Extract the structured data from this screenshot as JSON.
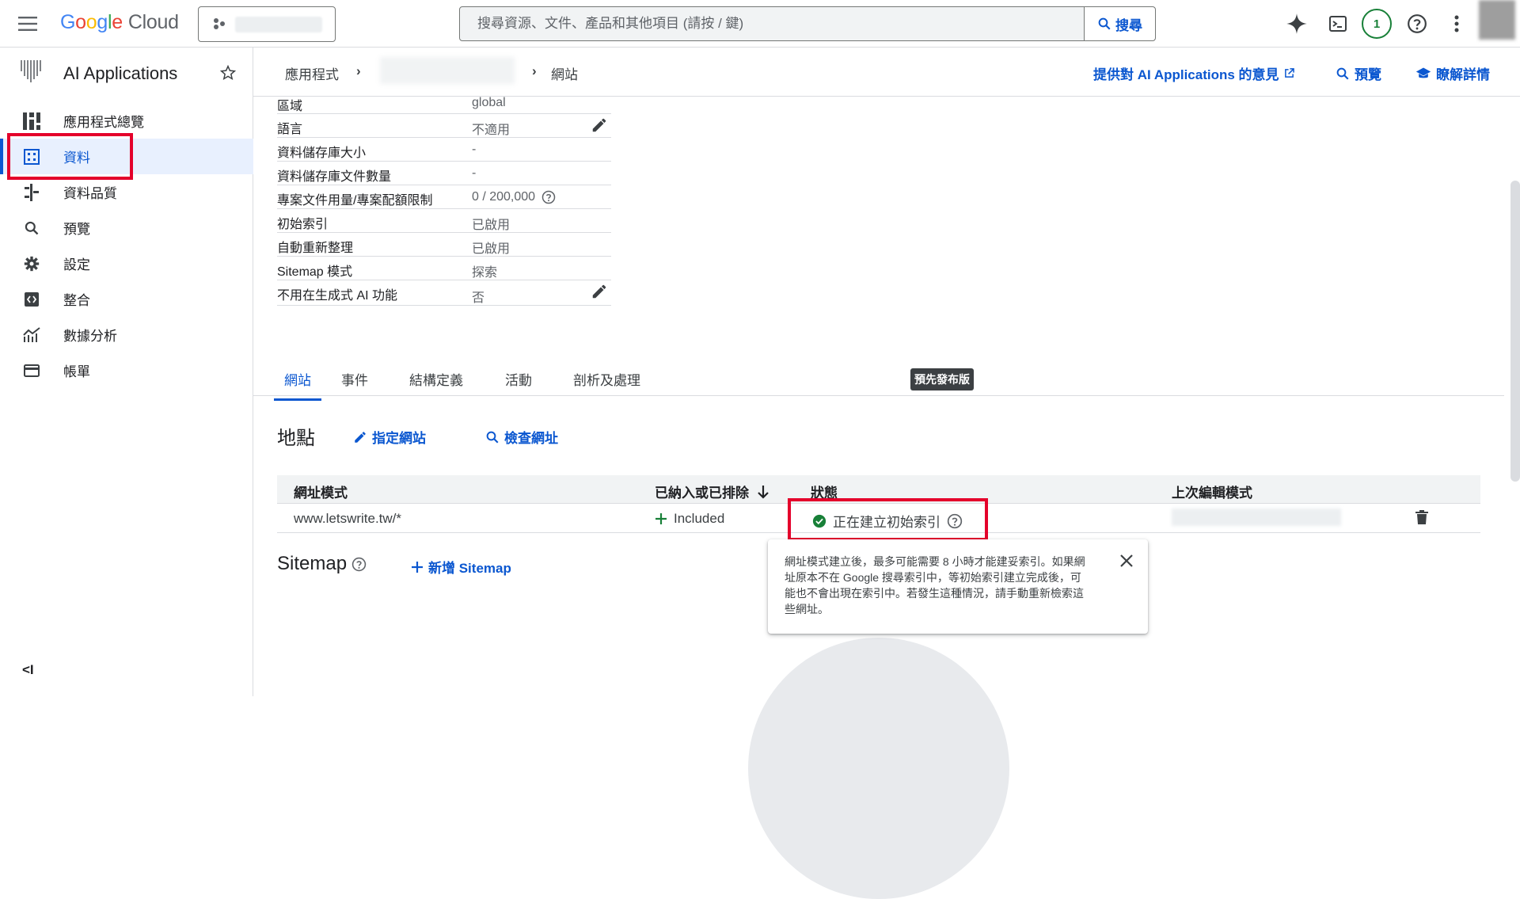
{
  "topbar": {
    "logo_google": "Google",
    "logo_cloud": "Cloud",
    "search_placeholder": "搜尋資源、文件、產品和其他項目 (請按 / 鍵)",
    "search_button": "搜尋",
    "notification_count": "1"
  },
  "sidebar": {
    "app_name": "AI Applications",
    "items": [
      {
        "label": "應用程式總覽",
        "icon": "dashboard-icon"
      },
      {
        "label": "資料",
        "icon": "table-icon"
      },
      {
        "label": "資料品質",
        "icon": "data-quality-icon"
      },
      {
        "label": "預覽",
        "icon": "search-icon"
      },
      {
        "label": "設定",
        "icon": "gear-icon"
      },
      {
        "label": "整合",
        "icon": "code-icon"
      },
      {
        "label": "數據分析",
        "icon": "analytics-icon"
      },
      {
        "label": "帳單",
        "icon": "billing-icon"
      }
    ],
    "collapse_label": "<I"
  },
  "breadcrumb": {
    "root": "應用程式",
    "current": "網站"
  },
  "header_links": {
    "feedback": "提供對 AI Applications 的意見",
    "preview": "預覽",
    "learn_more": "瞭解詳情"
  },
  "details": [
    {
      "key": "區域",
      "value": "global"
    },
    {
      "key": "語言",
      "value": "不適用"
    },
    {
      "key": "資料儲存庫大小",
      "value": "-"
    },
    {
      "key": "資料儲存庫文件數量",
      "value": "-"
    },
    {
      "key": "專案文件用量/專案配額限制",
      "value": "0 / 200,000"
    },
    {
      "key": "初始索引",
      "value": "已啟用"
    },
    {
      "key": "自動重新整理",
      "value": "已啟用"
    },
    {
      "key": "Sitemap 模式",
      "value": "探索"
    },
    {
      "key": "不用在生成式 AI 功能",
      "value": "否"
    }
  ],
  "tabs": [
    "網站",
    "事件",
    "結構定義",
    "活動",
    "剖析及處理"
  ],
  "preview_badge": "預先發布版",
  "section": {
    "title": "地點",
    "specify_sites": "指定網站",
    "check_urls": "檢查網址"
  },
  "url_table": {
    "headers": [
      "網址模式",
      "已納入或已排除",
      "狀態",
      "上次編輯模式"
    ],
    "row": {
      "pattern": "www.letswrite.tw/*",
      "inclusion": "Included",
      "status": "正在建立初始索引"
    }
  },
  "sitemap": {
    "title": "Sitemap",
    "add": "新增 Sitemap"
  },
  "tooltip": {
    "text": "網址模式建立後，最多可能需要 8 小時才能建妥索引。如果網址原本不在 Google 搜尋索引中，等初始索引建立完成後，可能也不會出現在索引中。若發生這種情況，請手動重新檢索這些網址。"
  },
  "colors": {
    "accent": "#0b57d0",
    "success": "#188038",
    "highlight_box": "#e4002b"
  }
}
